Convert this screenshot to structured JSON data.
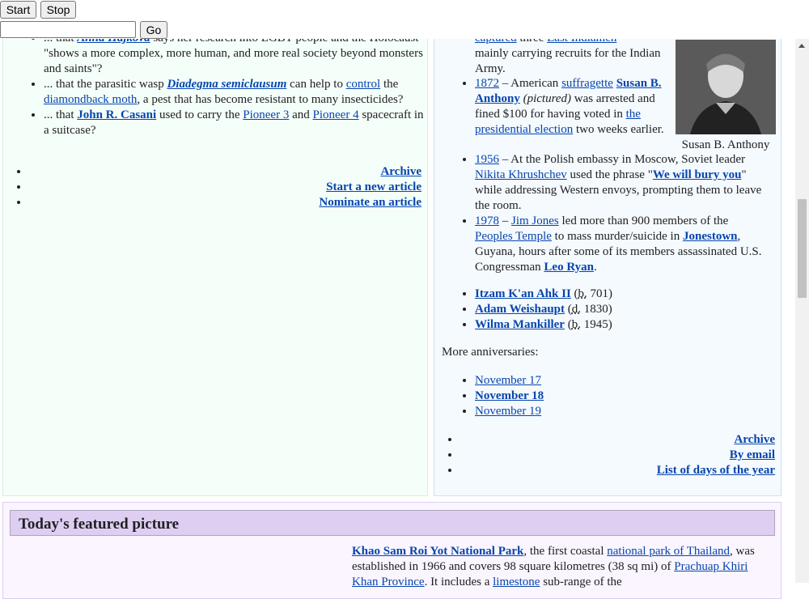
{
  "toolbar": {
    "start": "Start",
    "stop": "Stop",
    "go": "Go",
    "url_value": ""
  },
  "dyk": {
    "item0_part1": "... that",
    "item0_link": "Anna Hájková",
    "item0_part2": "says her research into LGBT people and the Holocaust \"shows a more complex, more human, and more real society beyond monsters and saints\"?",
    "item1_pre": "... that the parasitic wasp",
    "item1_wasp": "Diadegma semiclausum",
    "item1_mid": "can help to",
    "item1_control": "control",
    "item1_the": "the",
    "item1_moth": "diamondback moth",
    "item1_post": ", a pest that has become resistant to many insecticides?",
    "item2_pre": "... that",
    "item2_person": "John R. Casani",
    "item2_mid": "used to carry the",
    "item2_p3": "Pioneer 3",
    "item2_and": "and",
    "item2_p4": "Pioneer 4",
    "item2_post": "spacecraft in a suitcase?",
    "links": [
      "Archive",
      "Start a new article",
      "Nominate an article"
    ]
  },
  "otd": {
    "top_partial_links": "captured",
    "top_partial_text": "three",
    "top_partial_link2": "East Indiamen",
    "top_tail": "mainly carrying recruits for the Indian Army.",
    "e1_year": "1872",
    "e1_dash": " – American ",
    "e1_suff": "suffragette",
    "e1_name": "Susan B. Anthony",
    "e1_pic": "(pictured)",
    "e1_text1": " was arrested and fined $100 for having voted in ",
    "e1_elect": "the presidential election",
    "e1_text2": " two weeks earlier.",
    "e2_year": "1956",
    "e2_text1": " – At the Polish embassy in Moscow, Soviet leader ",
    "e2_nikita": "Nikita Khrushchev",
    "e2_text2": " used the phrase \"",
    "e2_phrase": "We will bury you",
    "e2_text3": "\" while addressing Western envoys, prompting them to leave the room.",
    "e3_year": "1978",
    "e3_dash": " – ",
    "e3_jim": "Jim Jones",
    "e3_text1": " led more than 900 members of the ",
    "e3_temple": "Peoples Temple",
    "e3_text2": " to mass murder/suicide in ",
    "e3_town": "Jonestown",
    "e3_text3": ", Guyana, hours after some of its members assassinated U.S. Congressman ",
    "e3_ryan": "Leo Ryan",
    "e3_end": ".",
    "photo_caption": "Susan B. Anthony",
    "births": [
      {
        "name": "Itzam K'an Ahk II",
        "abbr": "b.",
        "year": " 701)"
      },
      {
        "name": "Adam Weishaupt",
        "abbr": "d.",
        "year": " 1830)"
      },
      {
        "name": "Wilma Mankiller",
        "abbr": "b.",
        "year": " 1945)"
      }
    ],
    "more_label": "More anniversaries:",
    "days": [
      "November 17",
      "November 18",
      "November 19"
    ],
    "links": [
      "Archive",
      "By email",
      "List of days of the year"
    ]
  },
  "featured": {
    "heading": "Today's featured picture",
    "park": "Khao Sam Roi Yot National Park",
    "t1": ", the first coastal ",
    "np": "national park of Thailand",
    "t2": ", was established in 1966 and covers 98 square kilometres (38 sq mi) of ",
    "prov": "Prachuap Khiri Khan Province",
    "t3": ". It includes a ",
    "lime": "limestone",
    "t4": " sub-range of the"
  }
}
